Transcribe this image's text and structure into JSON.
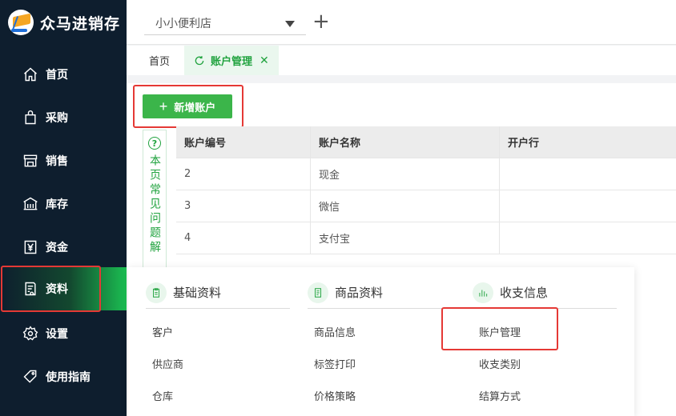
{
  "app": {
    "name": "众马进销存"
  },
  "sidebar": {
    "items": [
      {
        "label": "首页",
        "icon": "home-icon"
      },
      {
        "label": "采购",
        "icon": "bag-icon"
      },
      {
        "label": "销售",
        "icon": "store-icon"
      },
      {
        "label": "库存",
        "icon": "warehouse-icon"
      },
      {
        "label": "资金",
        "icon": "yen-icon"
      },
      {
        "label": "资料",
        "icon": "document-icon"
      },
      {
        "label": "设置",
        "icon": "gear-icon"
      },
      {
        "label": "使用指南",
        "icon": "tag-icon"
      }
    ],
    "active": "资料"
  },
  "header": {
    "store": "小小便利店"
  },
  "tabs": {
    "home": "首页",
    "active": "账户管理"
  },
  "toolbar": {
    "add_label": "新增账户"
  },
  "faq": {
    "label": "本页常见问题解"
  },
  "table": {
    "columns": [
      "账户编号",
      "账户名称",
      "开户行"
    ],
    "rows": [
      [
        "2",
        "现金",
        ""
      ],
      [
        "3",
        "微信",
        ""
      ],
      [
        "4",
        "支付宝",
        ""
      ]
    ]
  },
  "menu": {
    "columns": [
      {
        "title": "基础资料",
        "icon": "clipboard-icon",
        "items": [
          "客户",
          "供应商",
          "仓库"
        ]
      },
      {
        "title": "商品资料",
        "icon": "list-icon",
        "items": [
          "商品信息",
          "标签打印",
          "价格策略"
        ]
      },
      {
        "title": "收支信息",
        "icon": "bar-chart-icon",
        "items": [
          "账户管理",
          "收支类别",
          "结算方式"
        ]
      }
    ]
  },
  "colors": {
    "accent": "#3bb54a",
    "sidebar": "#0e1e2e",
    "highlight": "#e53935"
  }
}
